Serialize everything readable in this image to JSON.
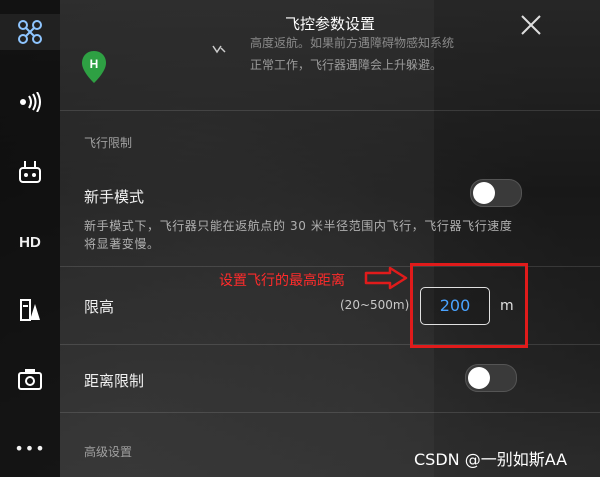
{
  "title": "飞控参数设置",
  "sidebar": {
    "items": [
      {
        "icon": "drone-icon"
      },
      {
        "icon": "signal-icon"
      },
      {
        "icon": "remote-controller-icon"
      },
      {
        "label": "HD"
      },
      {
        "icon": "battery-icon"
      },
      {
        "icon": "camera-icon"
      },
      {
        "label": "•••"
      }
    ]
  },
  "top_fragment": {
    "line1": "高度返航。如果前方遇障碍物感知系统",
    "line2": "正常工作，飞行器遇障会上升躲避。",
    "pin_letter": "H"
  },
  "flight_limit": {
    "section": "飞行限制",
    "novice_mode": {
      "label": "新手模式",
      "on": false,
      "desc": "新手模式下，飞行器只能在返航点的 30 米半径范围内飞行，飞行器飞行速度将显著变慢。"
    },
    "altitude": {
      "label": "限高",
      "range": "(20~500m)",
      "value": "200",
      "unit": "m"
    },
    "distance_limit": {
      "label": "距离限制",
      "on": false
    }
  },
  "advanced": {
    "section": "高级设置"
  },
  "annotation": "设置飞行的最高距离",
  "watermark": "CSDN @一别如斯AA",
  "colors": {
    "accent": "#4aa3ff",
    "annotation": "#e01b1b"
  }
}
